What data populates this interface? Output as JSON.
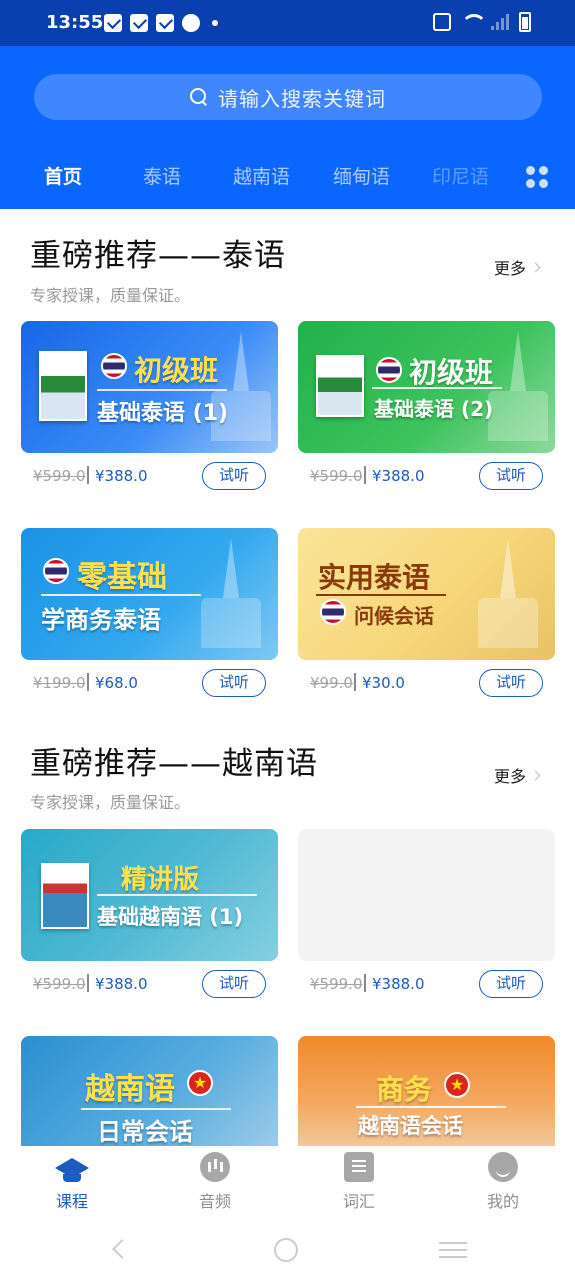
{
  "status_bar": {
    "time": "13:55"
  },
  "search": {
    "placeholder": "请输入搜索关键词"
  },
  "tabs": [
    {
      "label": "首页"
    },
    {
      "label": "泰语"
    },
    {
      "label": "越南语"
    },
    {
      "label": "缅甸语"
    },
    {
      "label": "印尼语"
    }
  ],
  "sections": [
    {
      "title": "重磅推荐——泰语",
      "subtitle": "专家授课，质量保证。",
      "more_label": "更多",
      "courses": [
        {
          "badge": "初级班",
          "name": "基础泰语 (1)",
          "old_price": "¥599.0",
          "price": "¥388.0",
          "listen_label": "试听"
        },
        {
          "badge": "初级班",
          "name": "基础泰语 (2)",
          "old_price": "¥599.0",
          "price": "¥388.0",
          "listen_label": "试听"
        },
        {
          "badge": "零基础",
          "name": "学商务泰语",
          "old_price": "¥199.0",
          "price": "¥68.0",
          "listen_label": "试听"
        },
        {
          "badge": "实用泰语",
          "name": "问候会话",
          "old_price": "¥99.0",
          "price": "¥30.0",
          "listen_label": "试听"
        }
      ]
    },
    {
      "title": "重磅推荐——越南语",
      "subtitle": "专家授课，质量保证。",
      "more_label": "更多",
      "courses": [
        {
          "badge": "精讲版",
          "name": "基础越南语 (1)",
          "old_price": "¥599.0",
          "price": "¥388.0",
          "listen_label": "试听"
        },
        {
          "badge": "",
          "name": "",
          "old_price": "¥599.0",
          "price": "¥388.0",
          "listen_label": "试听"
        },
        {
          "badge": "越南语",
          "name": "日常会话"
        },
        {
          "badge": "商务",
          "name": "越南语会话"
        }
      ]
    }
  ],
  "bottom_nav": [
    {
      "label": "课程",
      "icon": "graduation-cap-icon",
      "active": true
    },
    {
      "label": "音频",
      "icon": "audio-icon",
      "active": false
    },
    {
      "label": "词汇",
      "icon": "vocabulary-icon",
      "active": false
    },
    {
      "label": "我的",
      "icon": "profile-icon",
      "active": false
    }
  ],
  "colors": {
    "header_blue": "#0b66ff",
    "status_blue": "#0a3fb0",
    "accent_blue": "#1d5bbf"
  }
}
